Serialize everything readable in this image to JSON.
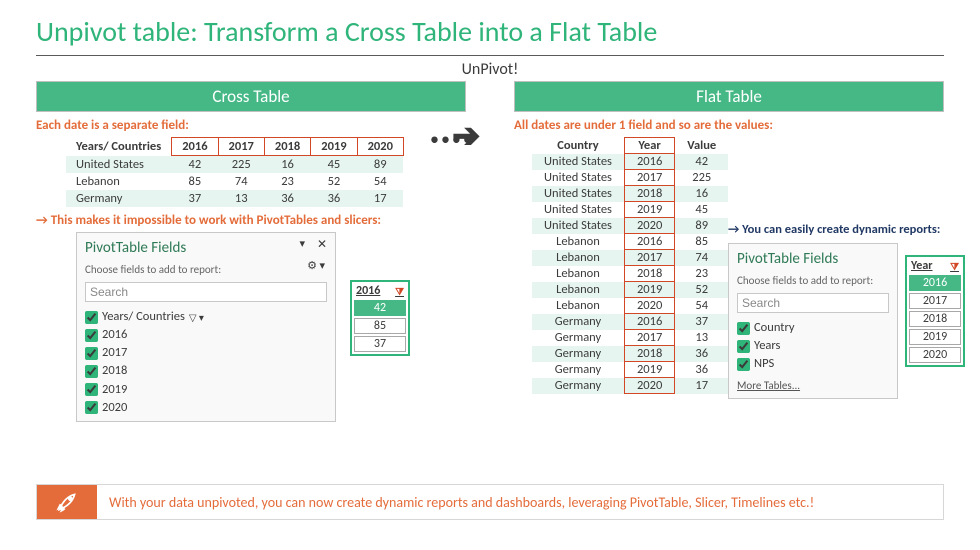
{
  "title": "Unpivot table: Transform a Cross Table into a Flat Table",
  "unpivot_label": "UnPivot!",
  "left": {
    "header": "Cross Table",
    "caption": "Each date is a separate field:",
    "corner": "Years/ Countries",
    "years": [
      "2016",
      "2017",
      "2018",
      "2019",
      "2020"
    ],
    "rows": [
      {
        "c": "United States",
        "v": [
          "42",
          "225",
          "16",
          "45",
          "89"
        ]
      },
      {
        "c": "Lebanon",
        "v": [
          "85",
          "74",
          "23",
          "52",
          "54"
        ]
      },
      {
        "c": "Germany",
        "v": [
          "37",
          "13",
          "36",
          "36",
          "17"
        ]
      }
    ],
    "caption2": "→ This makes it impossible to work with PivotTables and slicers:",
    "ptf": {
      "title": "PivotTable Fields",
      "sub": "Choose fields to add to report:",
      "search_ph": "Search",
      "field0": "Years/ Countries",
      "y": [
        "2016",
        "2017",
        "2018",
        "2019",
        "2020"
      ]
    },
    "slicer": {
      "head": "2016",
      "items": [
        "42",
        "85",
        "37"
      ]
    }
  },
  "right": {
    "header": "Flat Table",
    "caption": "All dates are under 1 field and so are the values:",
    "cols": [
      "Country",
      "Year",
      "Value"
    ],
    "rows": [
      [
        "United States",
        "2016",
        "42"
      ],
      [
        "United States",
        "2017",
        "225"
      ],
      [
        "United States",
        "2018",
        "16"
      ],
      [
        "United States",
        "2019",
        "45"
      ],
      [
        "United States",
        "2020",
        "89"
      ],
      [
        "Lebanon",
        "2016",
        "85"
      ],
      [
        "Lebanon",
        "2017",
        "74"
      ],
      [
        "Lebanon",
        "2018",
        "23"
      ],
      [
        "Lebanon",
        "2019",
        "52"
      ],
      [
        "Lebanon",
        "2020",
        "54"
      ],
      [
        "Germany",
        "2016",
        "37"
      ],
      [
        "Germany",
        "2017",
        "13"
      ],
      [
        "Germany",
        "2018",
        "36"
      ],
      [
        "Germany",
        "2019",
        "36"
      ],
      [
        "Germany",
        "2020",
        "17"
      ]
    ],
    "note": "→ You can easily create dynamic reports:",
    "ptf": {
      "title": "PivotTable Fields",
      "sub": "Choose fields to add to report:",
      "search_ph": "Search",
      "fields": [
        "Country",
        "Years",
        "NPS"
      ],
      "more": "More Tables..."
    },
    "slicer": {
      "head": "Year",
      "items": [
        "2016",
        "2017",
        "2018",
        "2019",
        "2020"
      ]
    }
  },
  "tip": "With your data unpivoted, you can now create dynamic reports and dashboards, leveraging PivotTable, Slicer, Timelines etc.!"
}
